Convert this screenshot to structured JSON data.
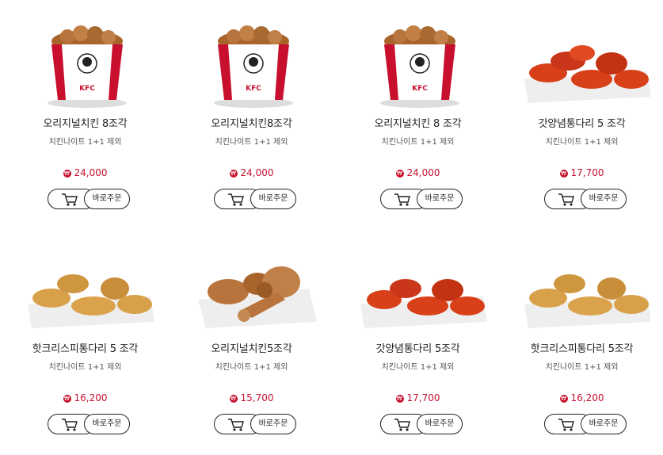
{
  "products": [
    {
      "name": "오리지널치킨 8조각",
      "note": "치킨나이트 1+1 제외",
      "price": "24,000",
      "image": "kfc-bucket"
    },
    {
      "name": "오리지널치킨8조각",
      "note": "치킨나이트 1+1 제외",
      "price": "24,000",
      "image": "kfc-bucket"
    },
    {
      "name": "오리지널치킨 8 조각",
      "note": "치킨나이트 1+1 제외",
      "price": "24,000",
      "image": "kfc-bucket"
    },
    {
      "name": "갓양념통다리 5 조각",
      "note": "치킨나이트 1+1 제외",
      "price": "17,700",
      "image": "sauced-drumsticks"
    },
    {
      "name": "핫크리스피통다리 5 조각",
      "note": "치킨나이트 1+1 제외",
      "price": "16,200",
      "image": "crispy-drumsticks"
    },
    {
      "name": "오리지널치킨5조각",
      "note": "치킨나이트 1+1 제외",
      "price": "15,700",
      "image": "original-pieces"
    },
    {
      "name": "갓양념통다리 5조각",
      "note": "치킨나이트 1+1 제외",
      "price": "17,700",
      "image": "sauced-drumsticks"
    },
    {
      "name": "핫크리스피통다리 5조각",
      "note": "치킨나이트 1+1 제외",
      "price": "16,200",
      "image": "crispy-drumsticks"
    }
  ],
  "labels": {
    "order": "바로주문",
    "currency_symbol": "₩",
    "bucket_brand": "KFC"
  },
  "colors": {
    "price": "#c8102e",
    "bucket_red": "#c8102e",
    "sauce": "#d8401a",
    "crispy": "#d9a04a",
    "original": "#b8743c"
  }
}
